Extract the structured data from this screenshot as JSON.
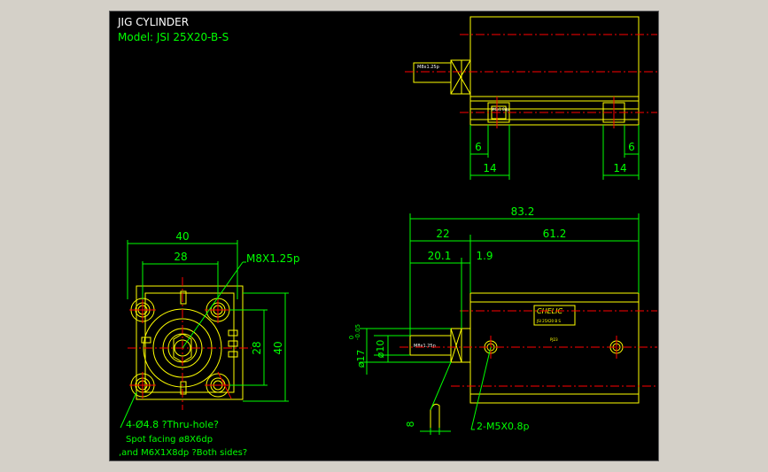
{
  "drawing": {
    "title": "JIG CYLINDER",
    "model": "Model: JSI 25X20-B-S"
  },
  "colors": {
    "background": "#000000",
    "frame": "#d4d0c8",
    "outline": "#ffff00",
    "dimension": "#00ff00",
    "centerline": "#ff0000",
    "white_text": "#ffffff"
  },
  "front_view": {
    "dim_width_outer": "40",
    "dim_width_inner": "28",
    "dim_height_inner": "28",
    "dim_height_outer": "40",
    "thread_label": "M8X1.25p",
    "note_line1": "4-Ø4.8 ?Thru-hole?",
    "note_line2": "Spot facing  ø8X6dp",
    "note_line3": ",and M6X1X8dp ?Both sides?"
  },
  "side_view": {
    "dim_total": "83.2",
    "dim_left": "22",
    "dim_right": "61.2",
    "dim_rod": "20.1",
    "dim_small": "1.9",
    "dim_rod_dia": "ø10",
    "dim_body_dia": "ø17",
    "dim_tol_upper": "0",
    "dim_tol_lower": "-0.05",
    "dim_wrench": "8",
    "port_label": "2-M5X0.8p",
    "thread_tag": "M8x1.25p",
    "brand": "CHELIC"
  },
  "top_view": {
    "dim_left_6": "6",
    "dim_right_6": "6",
    "dim_left_14": "14",
    "dim_right_14": "14",
    "thread_tag": "M8x1.25p"
  }
}
